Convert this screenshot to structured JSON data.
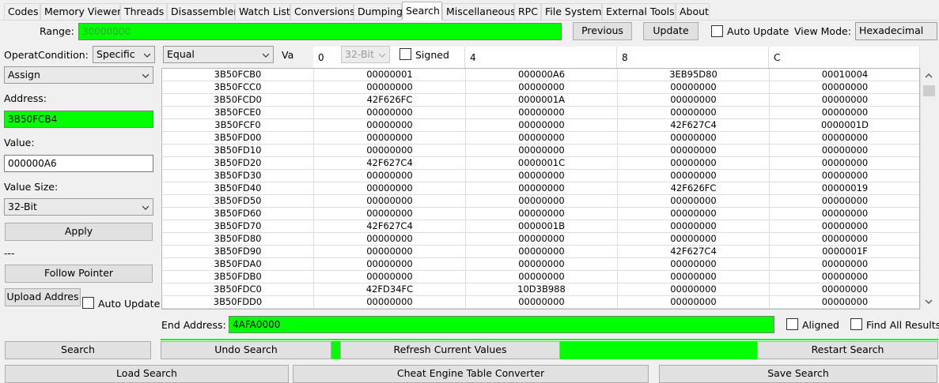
{
  "tabs": [
    "Codes",
    "Memory Viewer",
    "Threads",
    "Disassembler",
    "Watch List",
    "Conversions",
    "Dumping",
    "Search",
    "Miscellaneous",
    "RPC",
    "File System",
    "External Tools",
    "About"
  ],
  "active_tab": "Search",
  "range": {
    "label": "Range:",
    "value": "30000000"
  },
  "previous_label": "Previous",
  "update_label": "Update",
  "auto_update_label": "Auto Update",
  "view_mode": {
    "label": "View Mode:",
    "value": "Hexadecimal"
  },
  "left": {
    "operation_label": "Operatic",
    "condition_label": "Condition:",
    "condition_value": "Specific",
    "operation_value": "Assign",
    "address_label": "Address:",
    "address_value": "3B50FCB4",
    "value_label": "Value:",
    "value_value": "000000A6",
    "value_size_label": "Value Size:",
    "value_size_value": "32-Bit",
    "apply_label": "Apply",
    "separator": "---",
    "follow_pointer_label": "Follow Pointer",
    "upload_label": "Upload Addres",
    "auto_update_label": "Auto Update"
  },
  "search_options": {
    "comparison_value": "Equal",
    "value_label_partial": "Va",
    "bits_value": "32-Bit",
    "signed_label": "Signed"
  },
  "grid": {
    "headers": [
      "0",
      "4",
      "8",
      "C"
    ],
    "rows": [
      [
        "3B50FCB0",
        "00000001",
        "000000A6",
        "3EB95D80",
        "00010004"
      ],
      [
        "3B50FCC0",
        "00000000",
        "00000000",
        "00000000",
        "00000000"
      ],
      [
        "3B50FCD0",
        "42F626FC",
        "0000001A",
        "00000000",
        "00000000"
      ],
      [
        "3B50FCE0",
        "00000000",
        "00000000",
        "00000000",
        "00000000"
      ],
      [
        "3B50FCF0",
        "00000000",
        "00000000",
        "42F627C4",
        "0000001D"
      ],
      [
        "3B50FD00",
        "00000000",
        "00000000",
        "00000000",
        "00000000"
      ],
      [
        "3B50FD10",
        "00000000",
        "00000000",
        "00000000",
        "00000000"
      ],
      [
        "3B50FD20",
        "42F627C4",
        "0000001C",
        "00000000",
        "00000000"
      ],
      [
        "3B50FD30",
        "00000000",
        "00000000",
        "00000000",
        "00000000"
      ],
      [
        "3B50FD40",
        "00000000",
        "00000000",
        "42F626FC",
        "00000019"
      ],
      [
        "3B50FD50",
        "00000000",
        "00000000",
        "00000000",
        "00000000"
      ],
      [
        "3B50FD60",
        "00000000",
        "00000000",
        "00000000",
        "00000000"
      ],
      [
        "3B50FD70",
        "42F627C4",
        "0000001B",
        "00000000",
        "00000000"
      ],
      [
        "3B50FD80",
        "00000000",
        "00000000",
        "00000000",
        "00000000"
      ],
      [
        "3B50FD90",
        "00000000",
        "00000000",
        "42F627C4",
        "0000001F"
      ],
      [
        "3B50FDA0",
        "00000000",
        "00000000",
        "00000000",
        "00000000"
      ],
      [
        "3B50FDB0",
        "00000000",
        "00000000",
        "00000000",
        "00000000"
      ],
      [
        "3B50FDC0",
        "42FD34FC",
        "10D3B988",
        "00000000",
        "00000000"
      ],
      [
        "3B50FDD0",
        "00000000",
        "00000000",
        "00000000",
        "00000000"
      ]
    ]
  },
  "end_address": {
    "label": "End Address:",
    "value": "4AFA0000"
  },
  "aligned_label": "Aligned",
  "find_all_label": "Find All Results",
  "search_label": "Search",
  "undo_search_label": "Undo Search",
  "refresh_label": "Refresh Current Values",
  "restart_label": "Restart Search",
  "load_search_label": "Load Search",
  "converter_label": "Cheat Engine Table Converter",
  "save_search_label": "Save Search",
  "colors": {
    "highlight": "#00ff00",
    "button": "#e1e1e1",
    "background": "#f0f0f0"
  },
  "icons": [
    "chevron-down-icon",
    "scroll-up-icon",
    "scroll-down-icon"
  ]
}
